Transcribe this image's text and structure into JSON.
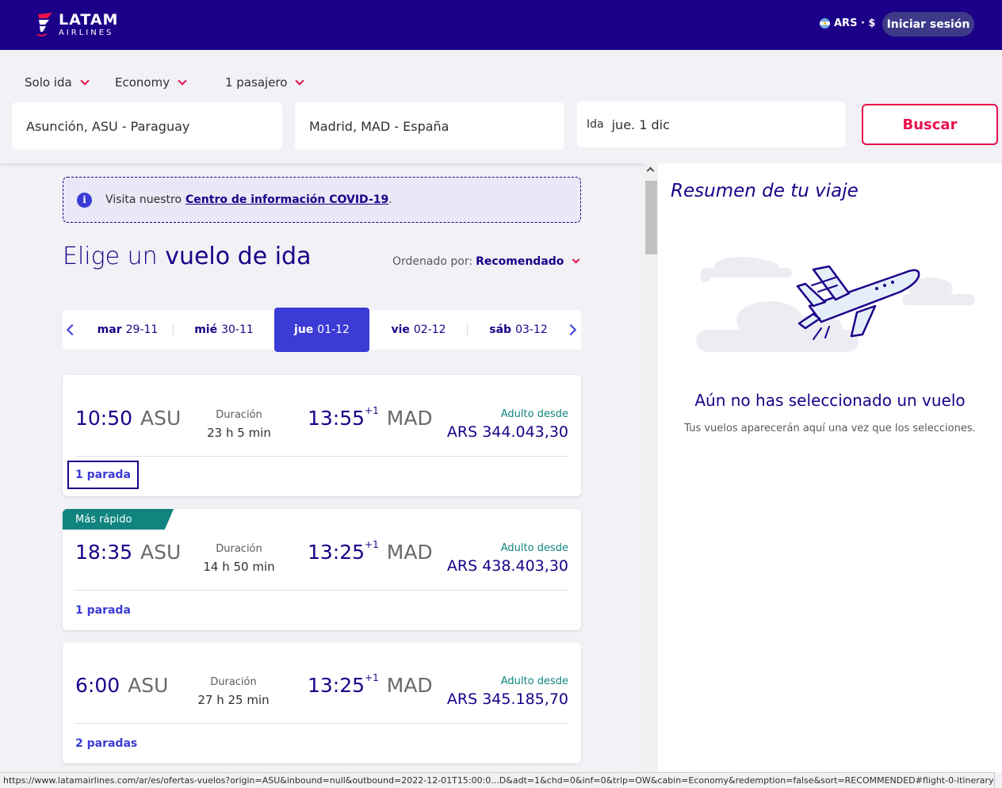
{
  "header": {
    "logo_title": "LATAM",
    "logo_subtitle": "AIRLINES",
    "currency": "ARS · $",
    "login_label": "Iniciar sesión"
  },
  "search": {
    "trip_type": "Solo ida",
    "cabin": "Economy",
    "passengers": "1 pasajero",
    "origin": "Asunción, ASU - Paraguay",
    "destination": "Madrid, MAD - España",
    "date_label": "Ida",
    "date_value": "jue. 1 dic",
    "search_button": "Buscar"
  },
  "covid": {
    "prefix": "Visita nuestro",
    "link": "Centro de información COVID-19",
    "suffix": "."
  },
  "results": {
    "title_light": "Elige un",
    "title_strong": "vuelo de ida",
    "sort_label": "Ordenado por:",
    "sort_value": "Recomendado",
    "dates": [
      {
        "day": "mar",
        "date": "29-11"
      },
      {
        "day": "mié",
        "date": "30-11"
      },
      {
        "day": "jue",
        "date": "01-12"
      },
      {
        "day": "vie",
        "date": "02-12"
      },
      {
        "day": "sáb",
        "date": "03-12"
      }
    ],
    "active_date_index": 2,
    "flights": [
      {
        "badge": "",
        "dep_time": "10:50",
        "dep_airport": "ASU",
        "duration_label": "Duración",
        "duration": "23 h 5 min",
        "arr_time": "13:55",
        "arr_plus": "+1",
        "arr_airport": "MAD",
        "price_label": "Adulto desde",
        "price": "ARS 344.043,30",
        "stops": "1 parada"
      },
      {
        "badge": "Más rápido",
        "dep_time": "18:35",
        "dep_airport": "ASU",
        "duration_label": "Duración",
        "duration": "14 h 50 min",
        "arr_time": "13:25",
        "arr_plus": "+1",
        "arr_airport": "MAD",
        "price_label": "Adulto desde",
        "price": "ARS 438.403,30",
        "stops": "1 parada"
      },
      {
        "badge": "",
        "dep_time": "6:00",
        "dep_airport": "ASU",
        "duration_label": "Duración",
        "duration": "27 h 25 min",
        "arr_time": "13:25",
        "arr_plus": "+1",
        "arr_airport": "MAD",
        "price_label": "Adulto desde",
        "price": "ARS 345.185,70",
        "stops": "2 paradas"
      }
    ]
  },
  "summary": {
    "title": "Resumen de tu viaje",
    "empty_title": "Aún no has seleccionado un vuelo",
    "empty_desc": "Tus vuelos aparecerán aquí una vez que los selecciones.",
    "illustration_icon": "airplane-clouds-icon"
  },
  "status_url": "https://www.latamairlines.com/ar/es/ofertas-vuelos?origin=ASU&inbound=null&outbound=2022-12-01T15:00:0...D&adt=1&chd=0&inf=0&trip=OW&cabin=Economy&redemption=false&sort=RECOMMENDED#flight-0-itinerary-detail",
  "colors": {
    "brand": "#1b0088",
    "accent": "#e8114b",
    "active_date": "#3b3bd6",
    "teal": "#10857f"
  }
}
